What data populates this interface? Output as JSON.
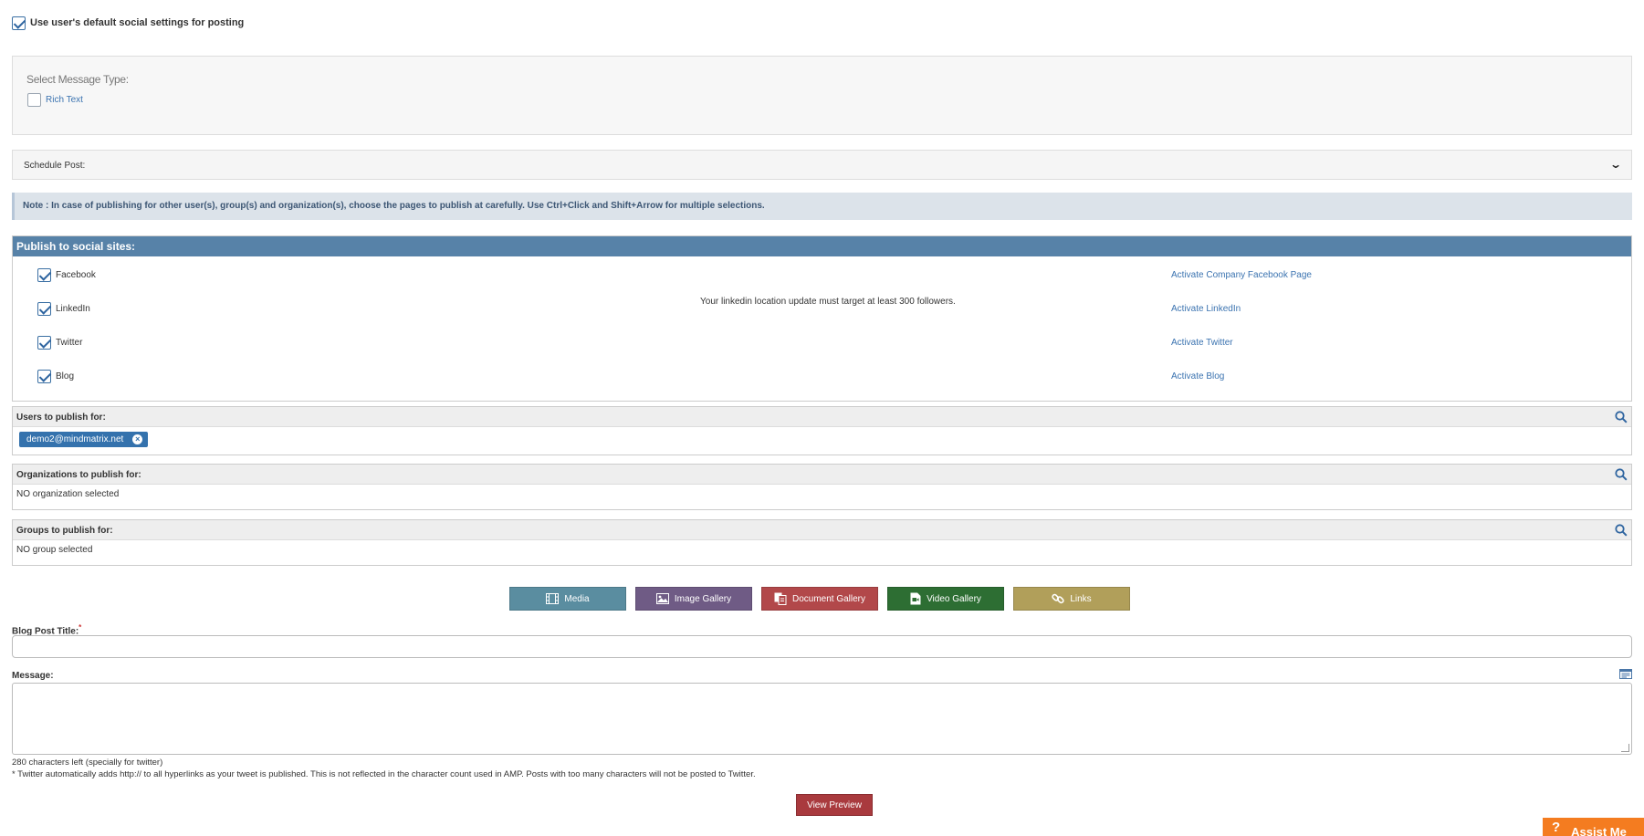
{
  "default_settings": {
    "label": "Use user's default social settings for posting",
    "checked": true
  },
  "message_type": {
    "title": "Select Message Type:",
    "rich_text_label": "Rich Text",
    "rich_text_checked": false
  },
  "schedule": {
    "label": "Schedule Post:",
    "icon": "chevron-down-icon"
  },
  "note": {
    "text": "Note : In case of publishing for other user(s), group(s) and organization(s), choose the pages to publish at carefully. Use Ctrl+Click and Shift+Arrow for multiple selections."
  },
  "publish": {
    "title": "Publish to social sites:",
    "sites": [
      {
        "label": "Facebook",
        "checked": true,
        "activate": "Activate Company Facebook Page"
      },
      {
        "label": "LinkedIn",
        "checked": true,
        "activate": "Activate LinkedIn"
      },
      {
        "label": "Twitter",
        "checked": true,
        "activate": "Activate Twitter"
      },
      {
        "label": "Blog",
        "checked": true,
        "activate": "Activate Blog"
      }
    ],
    "linkedin_note": "Your linkedin location update must target at least 300 followers."
  },
  "users": {
    "title": "Users to publish for:",
    "tags": [
      "demo2@mindmatrix.net"
    ]
  },
  "organizations": {
    "title": "Organizations to publish for:",
    "empty": "NO organization selected"
  },
  "groups": {
    "title": "Groups to publish for:",
    "empty": "NO group selected"
  },
  "galleries": [
    {
      "label": "Media",
      "icon": "film-icon",
      "color": "#5a8da0"
    },
    {
      "label": "Image Gallery",
      "icon": "image-icon",
      "color": "#6f5b85"
    },
    {
      "label": "Document Gallery",
      "icon": "documents-icon",
      "color": "#b2484a"
    },
    {
      "label": "Video Gallery",
      "icon": "video-file-icon",
      "color": "#2d6e33"
    },
    {
      "label": "Links",
      "icon": "link-icon",
      "color": "#b19f5a"
    }
  ],
  "blog_title": {
    "label": "Blog Post Title:",
    "required_mark": "*",
    "value": ""
  },
  "message": {
    "label": "Message:",
    "value": ""
  },
  "hints": {
    "chars_left": "280 characters left (specially for twitter)",
    "twitter_note": "* Twitter automatically adds http:// to all hyperlinks as your tweet is published. This is not reflected in the character count used in AMP. Posts with too many characters will not be posted to Twitter."
  },
  "preview_button": "View Preview",
  "assist": {
    "icon": "?",
    "label": "Assist Me"
  }
}
